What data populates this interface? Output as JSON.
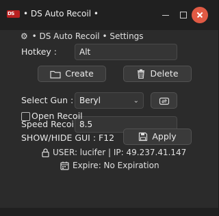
{
  "window": {
    "title": "• DS Auto Recoil •",
    "app_icon_text": "DS",
    "accent": "#b81f1f",
    "close_color": "#e05a44"
  },
  "settings": {
    "heading": "• DS Auto Recoil • Settings",
    "gear_icon": "⚙"
  },
  "hotkey": {
    "label": "Hotkey :",
    "value": "Alt"
  },
  "buttons": {
    "create": "Create",
    "delete": "Delete",
    "apply": "Apply"
  },
  "gun": {
    "label": "Select Gun :",
    "selected": "Beryl"
  },
  "speed": {
    "label": "Speed Recoil",
    "value": "8.5"
  },
  "open_recoil": {
    "label": "Open Recoil",
    "checked": false
  },
  "show_hide": "SHOW/HIDE GUI : F12",
  "user_info": "USER: lucifer | IP: 49.237.41.147",
  "expire": "Expire: No Expiration"
}
